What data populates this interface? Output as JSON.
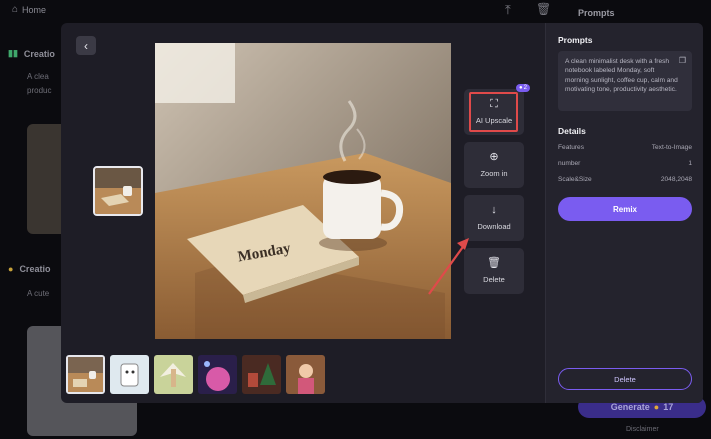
{
  "background": {
    "home_label": "Home",
    "prompts_title": "Prompts",
    "creation_label_1": "Creatio",
    "creation_text_1a": "A clea",
    "creation_text_1b": "produc",
    "creation_label_2": "Creatio",
    "creation_text_2": "A cute",
    "generate_label": "Generate",
    "generate_cost": "17",
    "disclaimer": "Disclaimer"
  },
  "viewer": {
    "main_image_caption": "Monday",
    "tools": [
      {
        "label": "AI Upscale",
        "icon": "expand-icon"
      },
      {
        "label": "Zoom in",
        "icon": "zoom-in-icon"
      },
      {
        "label": "Download",
        "icon": "download-icon"
      },
      {
        "label": "Delete",
        "icon": "trash-icon"
      }
    ],
    "upscale_badge": "2",
    "thumbnails": [
      "desk-monday",
      "cartoon-note",
      "angel",
      "pink-planet",
      "christmas-room",
      "girl-portrait"
    ]
  },
  "panel": {
    "prompts_title": "Prompts",
    "prompt_text": "A clean minimalist desk with a fresh notebook labeled Monday, soft morning sunlight, coffee cup, calm and motivating tone, productivity aesthetic.",
    "details_title": "Details",
    "details": [
      {
        "label": "Features",
        "value": "Text-to-Image"
      },
      {
        "label": "number",
        "value": "1"
      },
      {
        "label": "Scale&Size",
        "value": "2048,2048"
      }
    ],
    "remix_label": "Remix",
    "delete_label": "Delete"
  },
  "colors": {
    "accent": "#7a5cf0",
    "highlight": "#e04a4a",
    "modal_bg": "#1e1d26"
  }
}
